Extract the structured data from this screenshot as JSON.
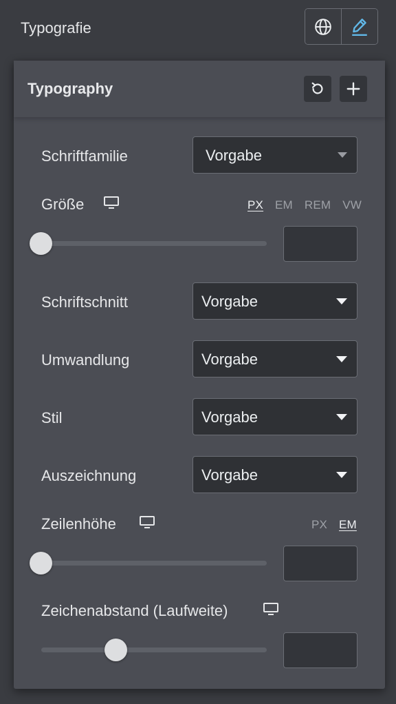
{
  "topbar": {
    "title": "Typografie",
    "globe_icon": "globe-icon",
    "edit_icon": "pencil-edit-icon",
    "accent_color": "#61b8e8"
  },
  "panel": {
    "title": "Typography",
    "reset_icon": "reset-icon",
    "add_icon": "plus-icon"
  },
  "controls": {
    "font_family": {
      "label": "Schriftfamilie",
      "value": "Vorgabe"
    },
    "size": {
      "label": "Größe",
      "device_icon": "desktop-icon",
      "units": [
        "PX",
        "EM",
        "REM",
        "VW"
      ],
      "active_unit": "PX",
      "slider_value": 0,
      "input_value": ""
    },
    "weight": {
      "label": "Schriftschnitt",
      "value": "Vorgabe"
    },
    "transform": {
      "label": "Umwandlung",
      "value": "Vorgabe"
    },
    "style": {
      "label": "Stil",
      "value": "Vorgabe"
    },
    "decoration": {
      "label": "Auszeichnung",
      "value": "Vorgabe"
    },
    "line_height": {
      "label": "Zeilenhöhe",
      "device_icon": "desktop-icon",
      "units": [
        "PX",
        "EM"
      ],
      "active_unit": "EM",
      "slider_value": 0,
      "input_value": ""
    },
    "letter_spacing": {
      "label": "Zeichenabstand (Laufweite)",
      "device_icon": "desktop-icon",
      "slider_value": 0.33,
      "input_value": ""
    }
  }
}
